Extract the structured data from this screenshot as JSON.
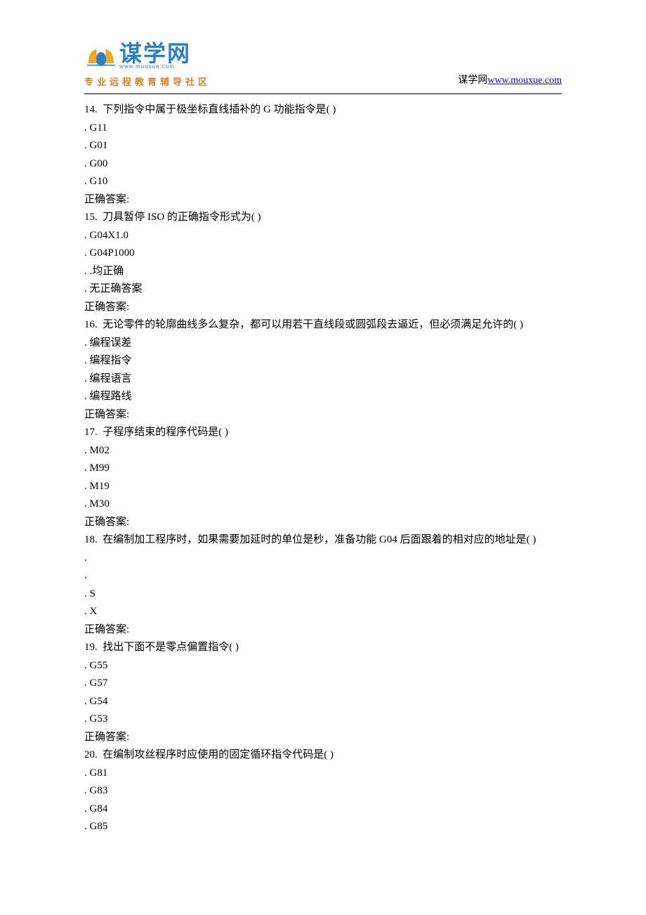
{
  "header": {
    "logo_main": "谋学网",
    "logo_sub": "www.mouxue.com",
    "tagline": "专业远程教育辅导社区",
    "right_label": "谋学网",
    "right_link": "www.mouxue.com"
  },
  "questions": [
    {
      "num": "14.",
      "text": "下列指令中属于极坐标直线插补的 G 功能指令是( )",
      "options": [
        ". G11",
        ". G01",
        ". G00",
        ". G10"
      ],
      "answer": "正确答案:"
    },
    {
      "num": "15.",
      "text": "刀具暂停 ISO 的正确指令形式为( )",
      "options": [
        ". G04X1.0",
        ". G04P1000",
        ". .均正确",
        ". 无正确答案"
      ],
      "answer": "正确答案:"
    },
    {
      "num": "16.",
      "text": "无论零件的轮廓曲线多么复杂，都可以用若干直线段或圆弧段去逼近，但必须满足允许的( )",
      "options": [
        ". 编程误差",
        ". 编程指令",
        ". 编程语言",
        ". 编程路线"
      ],
      "answer": "正确答案:"
    },
    {
      "num": "17.",
      "text": "子程序结束的程序代码是( )",
      "options": [
        ". M02",
        ". M99",
        ". M19",
        ". M30"
      ],
      "answer": "正确答案:"
    },
    {
      "num": "18.",
      "text": "在编制加工程序时，如果需要加延时的单位是秒，准备功能 G04 后面跟着的相对应的地址是( )",
      "options": [
        ".",
        ".",
        ". S",
        ". X"
      ],
      "answer": "正确答案:"
    },
    {
      "num": "19.",
      "text": "找出下面不是零点偏置指令( )",
      "options": [
        ". G55",
        ". G57",
        ". G54",
        ". G53"
      ],
      "answer": "正确答案:"
    },
    {
      "num": "20.",
      "text": "在编制攻丝程序时应使用的固定循环指令代码是( )",
      "options": [
        ". G81",
        ". G83",
        ". G84",
        ". G85"
      ],
      "answer": ""
    }
  ]
}
